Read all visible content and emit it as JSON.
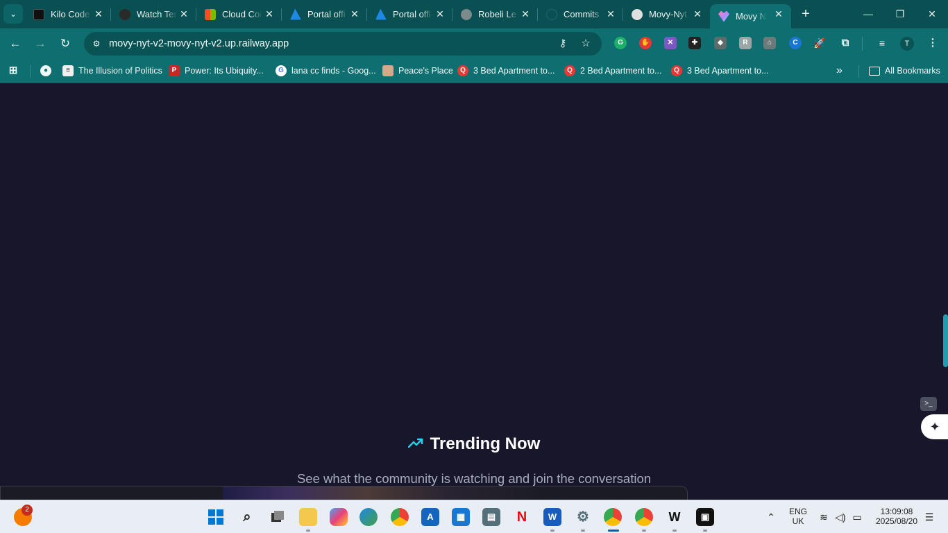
{
  "browser": {
    "tabs": [
      {
        "title": "Kilo Code",
        "icon": "kilo-code-icon",
        "color": "#111111"
      },
      {
        "title": "Watch Ter",
        "icon": "watch-icon",
        "color": "#2a2a2a"
      },
      {
        "title": "Cloud Cor",
        "icon": "microsoft-icon",
        "color": "#f25022"
      },
      {
        "title": "Portal offi",
        "icon": "azure-icon",
        "color": "#1e88e5"
      },
      {
        "title": "Portal offi",
        "icon": "azure-icon",
        "color": "#1e88e5"
      },
      {
        "title": "Robeli Le",
        "icon": "globe-icon",
        "color": "#7b8a8a"
      },
      {
        "title": "Commits",
        "icon": "github-icon",
        "color": "#0a4f51"
      },
      {
        "title": "Movy-Nyt",
        "icon": "movy-icon",
        "color": "#e0e0e0"
      },
      {
        "title": "Movy Nyt",
        "icon": "movy-heart-icon",
        "color": "#b388ff",
        "active": true
      }
    ],
    "new_tab": "+",
    "window": {
      "minimize": "—",
      "restore": "❐",
      "close": "✕"
    },
    "url": "movy-nyt-v2-movy-nyt-v2.up.railway.app",
    "profile_initial": "T",
    "bookmarks": [
      {
        "label": "The Illusion of Politics",
        "icon": "doc-icon",
        "color": "#ffffff"
      },
      {
        "label": "Power: Its Ubiquity...",
        "icon": "book-icon",
        "color": "#c62828"
      },
      {
        "label": "lana cc finds - Goog...",
        "icon": "google-icon",
        "color": "#ffffff"
      },
      {
        "label": "Peace's Place",
        "icon": "avatar-icon",
        "color": "#d7a98c"
      },
      {
        "label": "3 Bed Apartment to...",
        "icon": "property-icon",
        "color": "#e53935"
      },
      {
        "label": "2 Bed Apartment to...",
        "icon": "property-icon",
        "color": "#e53935"
      },
      {
        "label": "3 Bed Apartment to...",
        "icon": "property-icon",
        "color": "#e53935"
      }
    ],
    "more_bookmarks": "»",
    "all_bookmarks": "All Bookmarks"
  },
  "page": {
    "section_title": "Trending Now",
    "section_subtitle": "See what the community is watching and join the conversation",
    "accent_color": "#22d3ee",
    "background_color": "#17162a"
  },
  "taskbar": {
    "notification_count": "2",
    "language_top": "ENG",
    "language_bottom": "UK",
    "time": "13:09:08",
    "date": "2025/08/20"
  }
}
